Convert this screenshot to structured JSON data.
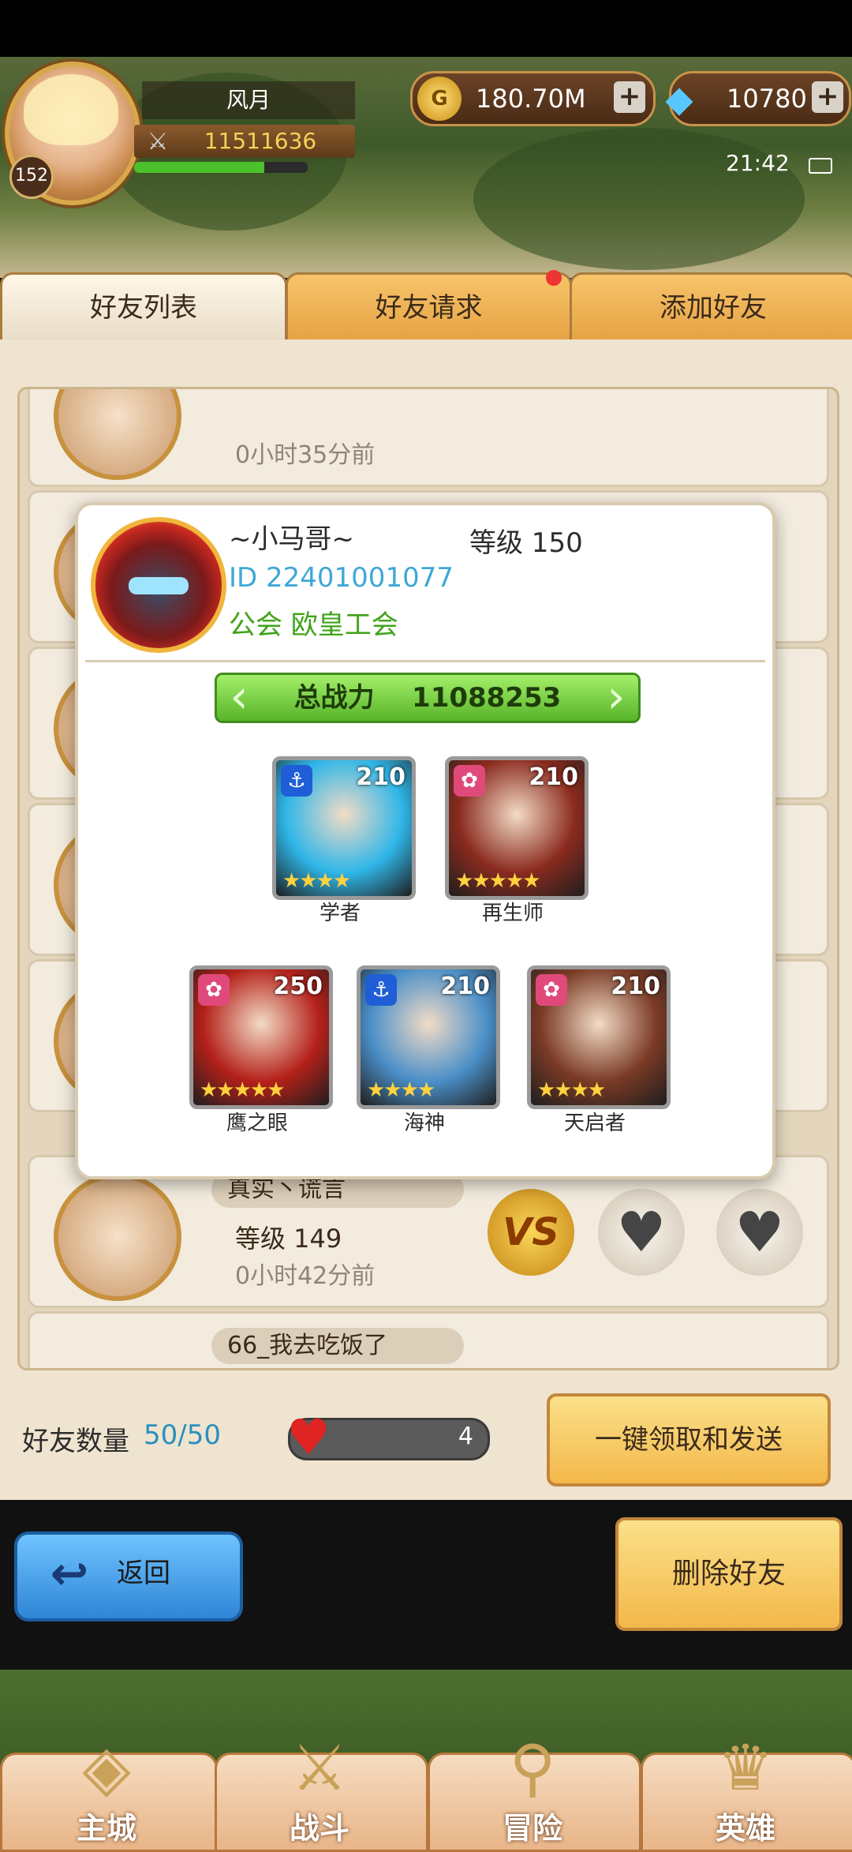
{
  "player": {
    "name": "风月",
    "level": "152",
    "power": "11511636",
    "xp_fraction": 0.75
  },
  "currency": {
    "gold": "180.70M",
    "gems": "10780",
    "coin_symbol": "G",
    "plus_symbol": "+"
  },
  "status": {
    "time": "21:42"
  },
  "tabs": [
    {
      "label": "好友列表",
      "active": true
    },
    {
      "label": "好友请求",
      "active": false,
      "has_badge": true
    },
    {
      "label": "添加好友",
      "active": false
    }
  ],
  "friends": [
    {
      "name": "",
      "level": "",
      "time": "0小时35分前"
    },
    {
      "name": "真实丶谎言",
      "level": "等级 149",
      "time": "0小时42分前"
    },
    {
      "name": "66_我去吃饭了",
      "level": "",
      "time": ""
    }
  ],
  "vs_label": "VS",
  "popup": {
    "name": "~小马哥~",
    "level": "等级 150",
    "id": "ID 22401001077",
    "guild": "公会 欧皇工会",
    "total_power_label": "总战力",
    "total_power": "11088253",
    "heroes": [
      {
        "name": "学者",
        "level": "210",
        "class": "anchor",
        "stars": "★★★★",
        "color": "#2fb6e8"
      },
      {
        "name": "再生师",
        "level": "210",
        "class": "lotus",
        "stars": "★★★★★",
        "color": "#8a2a1e"
      },
      {
        "name": "鹰之眼",
        "level": "250",
        "class": "lotus",
        "stars": "★★★★★",
        "color": "#b4201a"
      },
      {
        "name": "海神",
        "level": "210",
        "class": "anchor",
        "stars": "★★★★",
        "color": "#4a8fc8"
      },
      {
        "name": "天启者",
        "level": "210",
        "class": "lotus",
        "stars": "★★★★",
        "color": "#7a3a25"
      }
    ]
  },
  "footer": {
    "friend_count_label": "好友数量",
    "friend_count": "50/50",
    "gift_count": "4",
    "claim_button": "一键领取和发送",
    "back_button": "返回",
    "delete_button": "删除好友"
  },
  "nav": [
    {
      "label": "主城"
    },
    {
      "label": "战斗"
    },
    {
      "label": "冒险"
    },
    {
      "label": "英雄"
    }
  ]
}
